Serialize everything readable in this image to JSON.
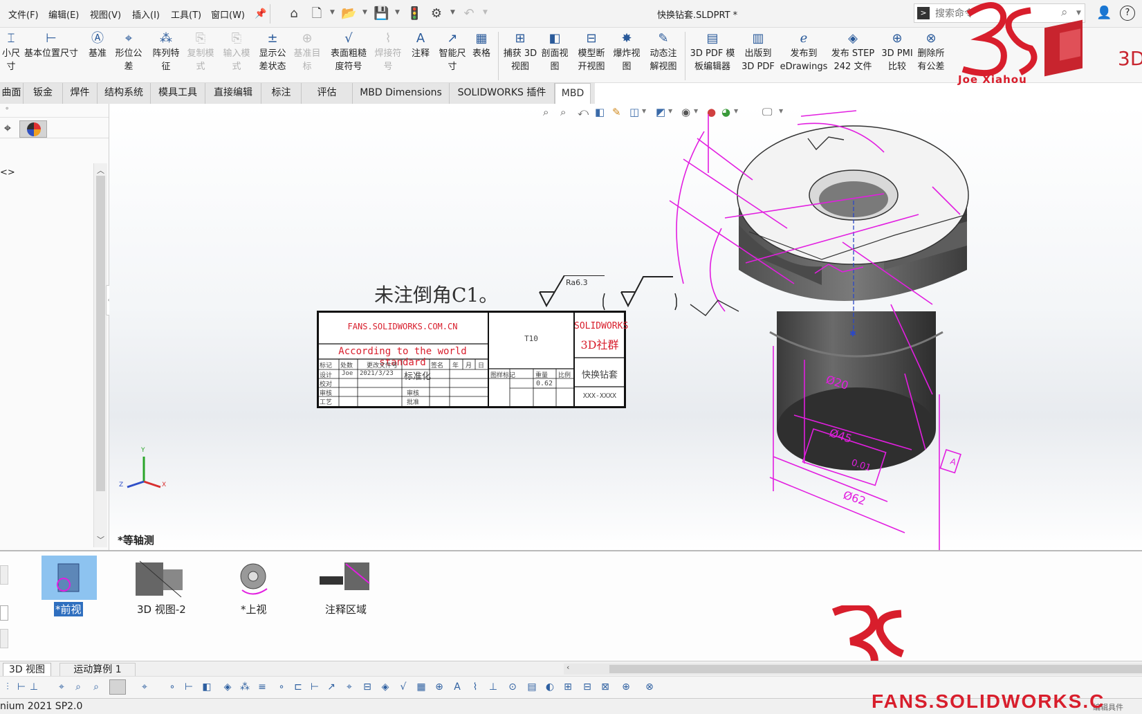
{
  "menubar": {
    "file": "文件(F)",
    "edit": "编辑(E)",
    "view": "视图(V)",
    "insert": "插入(I)",
    "tools": "工具(T)",
    "window": "窗口(W)",
    "document_title": "快换钻套.SLDPRT *",
    "search_placeholder": "搜索命令"
  },
  "ribbon": [
    {
      "label": "小尺\n寸",
      "icon": "dim-icon",
      "enabled": true
    },
    {
      "label": "基本位置尺寸",
      "icon": "location-dim-icon",
      "enabled": true
    },
    {
      "label": "基准",
      "icon": "datum-icon",
      "enabled": true
    },
    {
      "label": "形位公\n差",
      "icon": "gtol-icon",
      "enabled": true
    },
    {
      "label": "阵列特\n征",
      "icon": "pattern-icon",
      "enabled": true
    },
    {
      "label": "复制模\n式",
      "icon": "copy-scheme-icon",
      "enabled": false
    },
    {
      "label": "输入模\n式",
      "icon": "import-scheme-icon",
      "enabled": false
    },
    {
      "label": "显示公\n差状态",
      "icon": "tolerance-status-icon",
      "enabled": true
    },
    {
      "label": "基准目\n标",
      "icon": "datum-target-icon",
      "enabled": false
    },
    {
      "label": "表面粗糙\n度符号",
      "icon": "surface-finish-icon",
      "enabled": true
    },
    {
      "label": "焊接符\n号",
      "icon": "weld-symbol-icon",
      "enabled": false
    },
    {
      "label": "注释",
      "icon": "note-icon",
      "enabled": true
    },
    {
      "label": "智能尺\n寸",
      "icon": "smart-dim-icon",
      "enabled": true
    },
    {
      "label": "表格",
      "icon": "table-icon",
      "enabled": true
    },
    {
      "label": "捕获 3D\n视图",
      "icon": "capture-3d-view-icon",
      "enabled": true
    },
    {
      "label": "剖面视\n图",
      "icon": "section-view-icon",
      "enabled": true
    },
    {
      "label": "模型断\n开视图",
      "icon": "break-view-icon",
      "enabled": true
    },
    {
      "label": "爆炸视\n图",
      "icon": "explode-view-icon",
      "enabled": true
    },
    {
      "label": "动态注\n解视图",
      "icon": "dynamic-annotation-icon",
      "enabled": true
    },
    {
      "label": "3D PDF 模\n板编辑器",
      "icon": "pdf-template-icon",
      "enabled": true
    },
    {
      "label": "出版到\n3D PDF",
      "icon": "publish-pdf-icon",
      "enabled": true
    },
    {
      "label": "发布到\neDrawings",
      "icon": "edrawings-icon",
      "enabled": true
    },
    {
      "label": "发布 STEP\n242 文件",
      "icon": "step-icon",
      "enabled": true
    },
    {
      "label": "3D PMI\n比较",
      "icon": "pmi-compare-icon",
      "enabled": true
    },
    {
      "label": "删除所\n有公差",
      "icon": "delete-tolerance-icon",
      "enabled": true
    }
  ],
  "tabs": [
    "曲面",
    "钣金",
    "焊件",
    "结构系统",
    "模具工具",
    "直接编辑",
    "标注",
    "评估",
    "MBD Dimensions",
    "SOLIDWORKS 插件",
    "MBD"
  ],
  "active_tab": "MBD",
  "left_panel": {
    "tree_root": "<>"
  },
  "graphics": {
    "view_orientation": "*等轴测",
    "note_text": "未注倒角C1。",
    "surface_roughness": "Ra6.3",
    "title_block": {
      "website": "FANS.SOLIDWORKS.COM.CN",
      "slogan": "According to the world standard",
      "material": "T10",
      "company_line1": "SOLIDWORKS",
      "company_line2": "3D社群",
      "part_name": "快换钻套",
      "drawing_number": "XXX-XXXX",
      "hdr_mark": "标记",
      "hdr_count": "处数",
      "hdr_change": "更改文件号",
      "hdr_sign": "签名",
      "hdr_year": "年",
      "hdr_month": "月",
      "hdr_day": "日",
      "row_design": "设计",
      "designer": "Joe",
      "design_date": "2021/3/23",
      "standard": "标准化",
      "row_check": "校对",
      "row_audit": "审核",
      "row_process": "工艺",
      "row_approve": "批准",
      "stage": "图样标记",
      "weight_label": "重量",
      "weight": "0.62",
      "scale_label": "比例"
    },
    "triad": {
      "x": "X",
      "y": "Y",
      "z": "Z"
    },
    "dims": {
      "d20": "Ø20",
      "d45": "Ø45",
      "d62": "Ø62",
      "tol": "0.01",
      "datum": "A"
    },
    "watermark_name": "Joe Xiahou",
    "watermark_company": "3D"
  },
  "palette": {
    "views": [
      "*前视",
      "3D 视图-2",
      "*上视",
      "注释区域"
    ],
    "selected_view": "*前视"
  },
  "bottom_tabs": [
    "3D 视图",
    "运动算例 1"
  ],
  "statusbar": {
    "version": "nium 2021 SP2.0",
    "right_status": "编辑具件"
  },
  "brand": {
    "footer_url": "FANS.SOLIDWORKS.C",
    "accent": "#d81e2c",
    "annotation": "#e21ee0",
    "selection": "#8dc3f0"
  }
}
